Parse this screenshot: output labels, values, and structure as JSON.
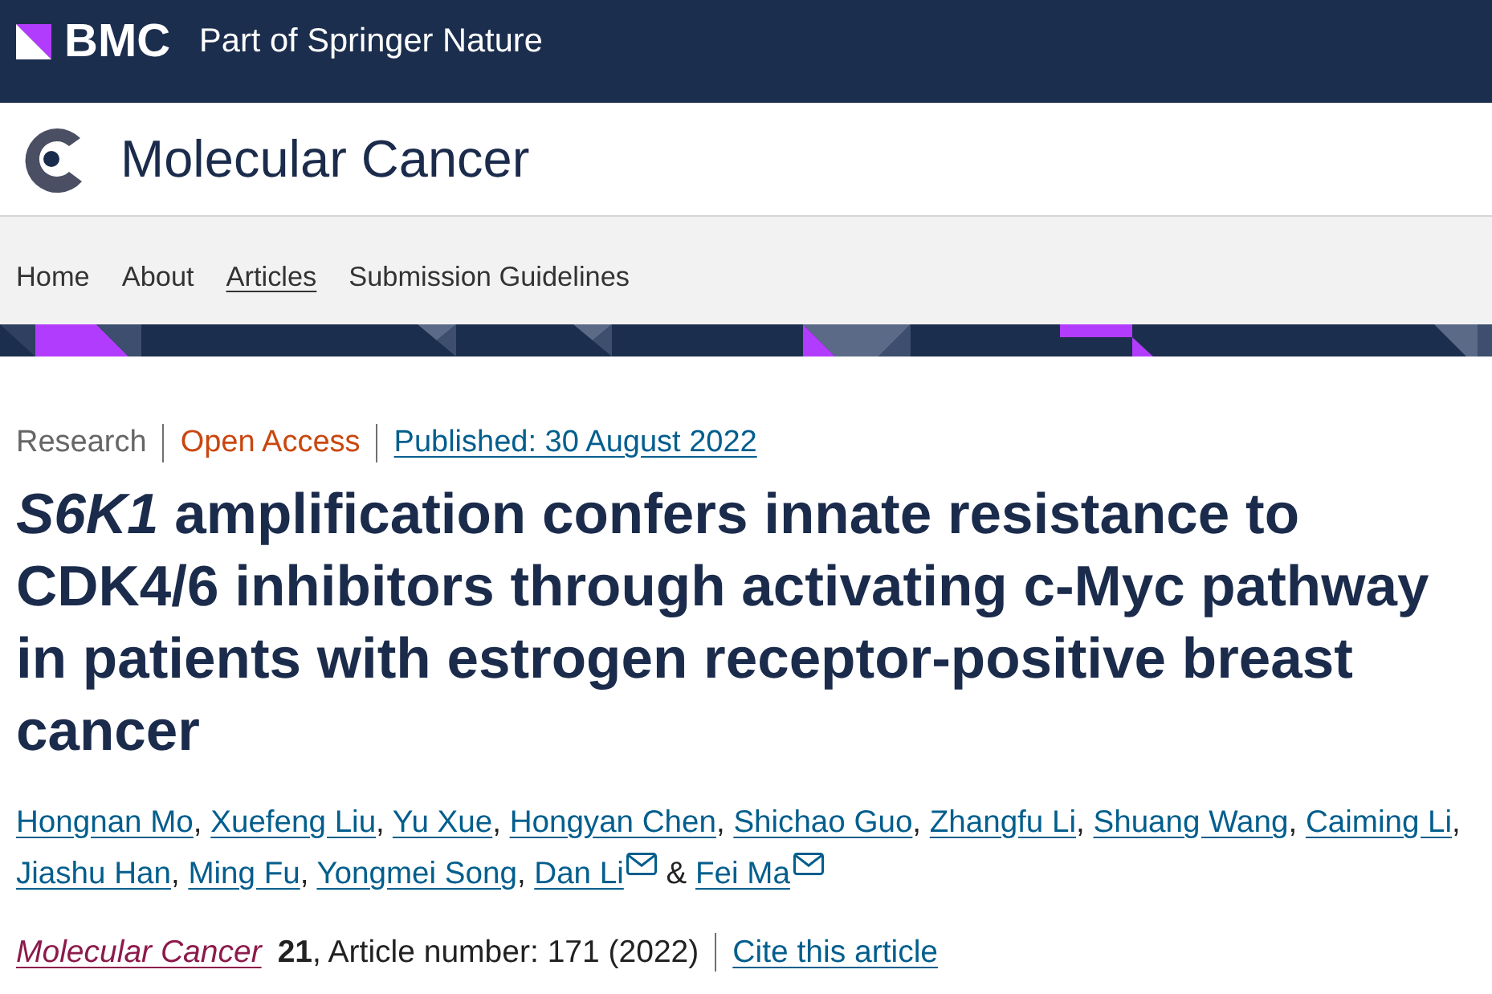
{
  "brand_bar": {
    "logo_text": "BMC",
    "tagline": "Part of Springer Nature"
  },
  "journal": {
    "title": "Molecular Cancer"
  },
  "nav": {
    "items": [
      {
        "label": "Home",
        "selected": false
      },
      {
        "label": "About",
        "selected": false
      },
      {
        "label": "Articles",
        "selected": true
      },
      {
        "label": "Submission Guidelines",
        "selected": false
      }
    ]
  },
  "article": {
    "type": "Research",
    "access": "Open Access",
    "published": "Published: 30 August 2022",
    "title": "*S6K1* amplification confers innate resistance to CDK4/6 inhibitors through activating c-Myc pathway in patients with estrogen receptor-positive breast cancer",
    "authors": [
      {
        "name": "Hongnan Mo",
        "corresponding": false,
        "separator": ","
      },
      {
        "name": "Xuefeng Liu",
        "corresponding": false,
        "separator": ","
      },
      {
        "name": "Yu Xue",
        "corresponding": false,
        "separator": ","
      },
      {
        "name": "Hongyan Chen",
        "corresponding": false,
        "separator": ","
      },
      {
        "name": "Shichao Guo",
        "corresponding": false,
        "separator": ","
      },
      {
        "name": "Zhangfu Li",
        "corresponding": false,
        "separator": ","
      },
      {
        "name": "Shuang Wang",
        "corresponding": false,
        "separator": ","
      },
      {
        "name": "Caiming Li",
        "corresponding": false,
        "separator": ","
      },
      {
        "name": "Jiashu Han",
        "corresponding": false,
        "separator": ","
      },
      {
        "name": "Ming Fu",
        "corresponding": false,
        "separator": ","
      },
      {
        "name": "Yongmei Song",
        "corresponding": false,
        "separator": ","
      },
      {
        "name": "Dan Li",
        "corresponding": true,
        "separator": "&"
      },
      {
        "name": "Fei Ma",
        "corresponding": true
      }
    ],
    "citation": {
      "journal": "Molecular Cancer",
      "details": "**21**, Article number: 171 (2022)",
      "cite_link": "Cite this article"
    }
  }
}
